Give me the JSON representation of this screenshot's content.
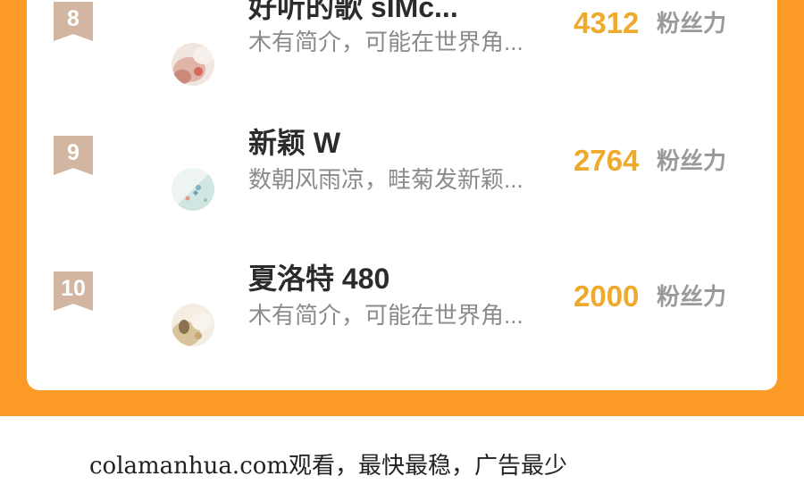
{
  "ranking": {
    "entries": [
      {
        "rank": "8",
        "name": "好听的歌  sIMc...",
        "bio": "木有简介，可能在世界角...",
        "fans": "4312",
        "fans_unit": "粉丝力",
        "avatar_icon": "avatar-pink-photo-icon"
      },
      {
        "rank": "9",
        "name": "新颖  W",
        "bio": "数朝风雨凉，畦菊发新颖...",
        "fans": "2764",
        "fans_unit": "粉丝力",
        "avatar_icon": "avatar-teal-pattern-icon"
      },
      {
        "rank": "10",
        "name": "夏洛特  480",
        "bio": "木有简介，可能在世界角...",
        "fans": "2000",
        "fans_unit": "粉丝力",
        "avatar_icon": "avatar-beige-photo-icon"
      }
    ]
  },
  "footer": {
    "text": "colamanhua.com观看，最快最稳，广告最少"
  },
  "colors": {
    "background_orange": "#fb9b25",
    "fan_count": "#eeaa2c",
    "rank_badge": "#d2b6a2"
  }
}
